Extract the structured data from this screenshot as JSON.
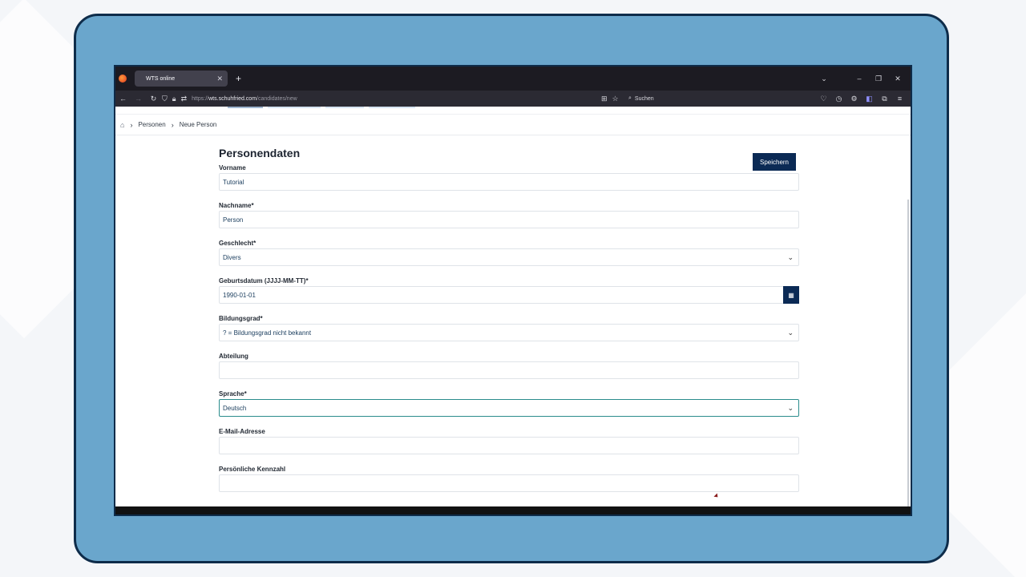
{
  "browser": {
    "tab_title": "WTS online",
    "tab_close": "✕",
    "new_tab": "+",
    "url_prefix": "https://",
    "url_domain": "wts.schuhfried.com",
    "url_path": "/candidates/new",
    "search_placeholder": "Suchen"
  },
  "breadcrumb": {
    "items": [
      "Personen",
      "Neue Person"
    ]
  },
  "form": {
    "title": "Personendaten",
    "save_label": "Speichern",
    "fields": {
      "vorname": {
        "label": "Vorname",
        "value": "Tutorial"
      },
      "nachname": {
        "label": "Nachname*",
        "value": "Person"
      },
      "geschlecht": {
        "label": "Geschlecht*",
        "value": "Divers"
      },
      "geburtsdatum": {
        "label": "Geburtsdatum (JJJJ-MM-TT)*",
        "value": "1990-01-01"
      },
      "bildungsgrad": {
        "label": "Bildungsgrad*",
        "value": "? = Bildungsgrad nicht bekannt"
      },
      "abteilung": {
        "label": "Abteilung",
        "value": ""
      },
      "sprache": {
        "label": "Sprache*",
        "value": "Deutsch"
      },
      "email": {
        "label": "E-Mail-Adresse",
        "value": ""
      },
      "kennzahl": {
        "label": "Persönliche Kennzahl",
        "value": ""
      }
    }
  },
  "colors": {
    "frame": "#6aa6cc",
    "frame_border": "#0e2c4a",
    "primary_button": "#0b2a55",
    "focus_border": "#2a8c8c"
  }
}
